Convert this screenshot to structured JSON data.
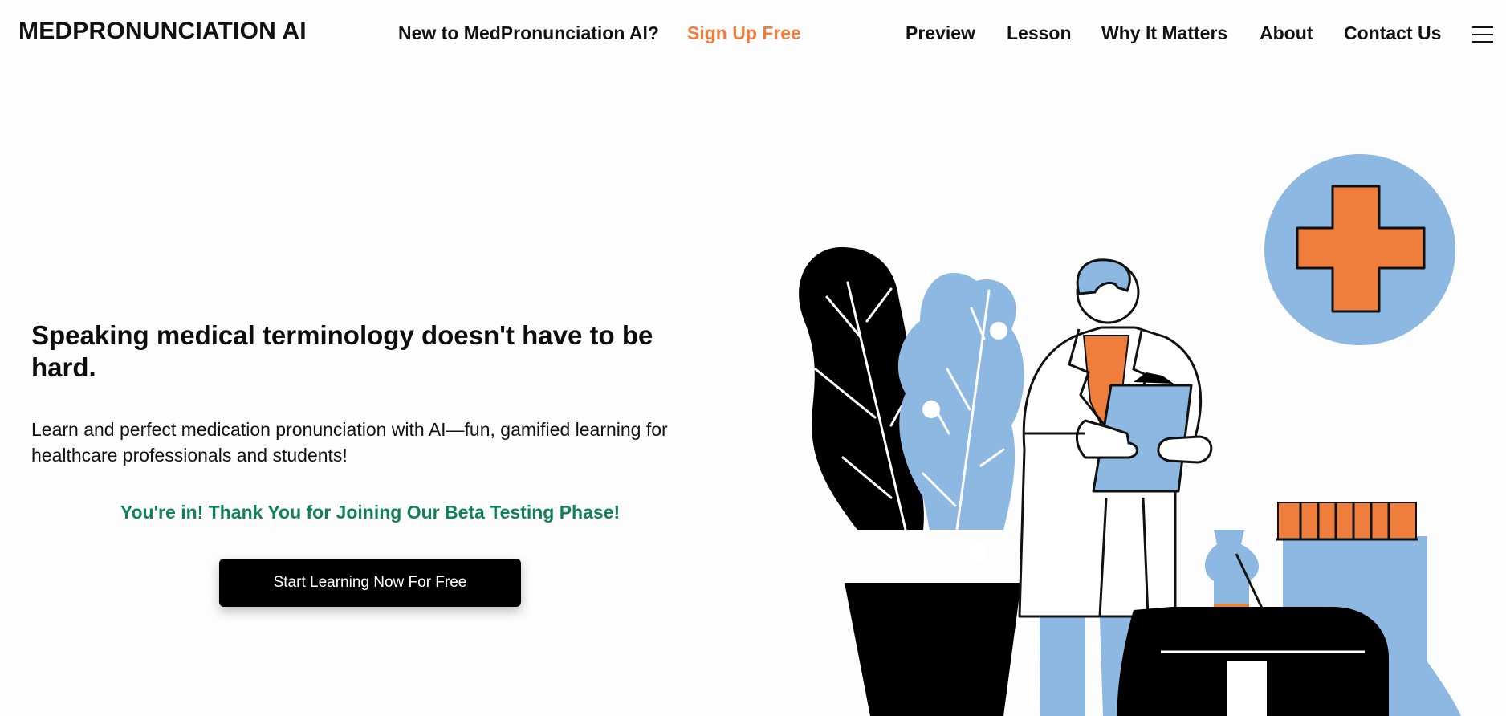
{
  "header": {
    "logo": "MEDPRONUNCIATION AI",
    "promo_question": "New to MedPronunciation AI?",
    "signup_label": "Sign Up Free",
    "nav": [
      {
        "label": "Preview"
      },
      {
        "label": "Lesson"
      },
      {
        "label": "Why It Matters"
      },
      {
        "label": "About"
      },
      {
        "label": "Contact Us"
      }
    ],
    "menu_icon": "hamburger-menu-icon"
  },
  "hero": {
    "title": "Speaking medical terminology doesn't have to be hard.",
    "description": "Learn and perfect medication pronunciation with AI—fun, gamified learning for healthcare professionals and students!",
    "beta_message": "You're in! Thank You for Joining Our Beta Testing Phase!",
    "cta_label": "Start Learning Now For Free"
  },
  "colors": {
    "accent_orange": "#ef7d3c",
    "success_green": "#10815a",
    "illustration_blue": "#8cb8e2",
    "button_black": "#000000"
  },
  "illustration": {
    "icon": "doctor-with-clipboard-illustration"
  }
}
